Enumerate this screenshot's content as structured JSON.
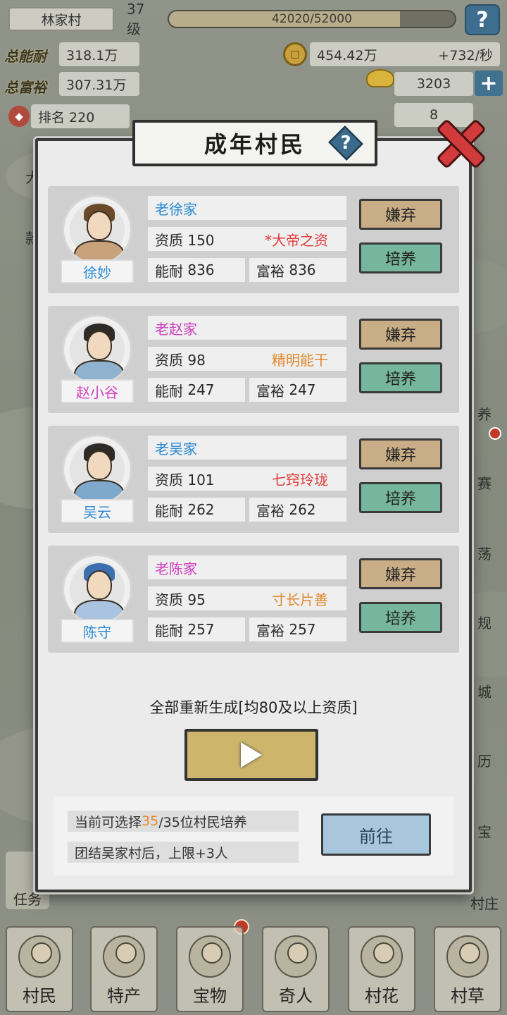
{
  "hud": {
    "village_name": "林家村",
    "level": "37级",
    "exp_text": "42020/52000",
    "exp_progress": 0.808,
    "total_ability_label": "总能耐",
    "total_ability": "318.1万",
    "total_wealth_label": "总富裕",
    "total_wealth": "307.31万",
    "rank": "排名 220",
    "coins": "454.42万",
    "coin_rate": "+732/秒",
    "ingots": "3203",
    "tickets": "8"
  },
  "side_menu": {
    "right": [
      "养",
      "赛",
      "荡",
      "规",
      "城",
      "历",
      "宝",
      "村庄"
    ],
    "left": [
      "大",
      "款"
    ],
    "task": "任务"
  },
  "modal": {
    "title": "成年村民",
    "help_icon": "question-icon",
    "close_icon": "close-x-icon",
    "villagers": [
      {
        "family": "老徐家",
        "name": "徐妙",
        "name_color": "#2a8ad4",
        "talent_label": "资质",
        "talent": "150",
        "trait": "*大帝之资",
        "trait_color": "#e03a3a",
        "ability_label": "能耐",
        "ability": "836",
        "wealth_label": "富裕",
        "wealth": "836",
        "hair_color": "#6b4a2b",
        "cloth_color": "#c7a27a"
      },
      {
        "family": "老赵家",
        "name": "赵小谷",
        "name_color": "#d13ec0",
        "talent_label": "资质",
        "talent": "98",
        "trait": "精明能干",
        "trait_color": "#e0892c",
        "ability_label": "能耐",
        "ability": "247",
        "wealth_label": "富裕",
        "wealth": "247",
        "hair_color": "#2f2a26",
        "cloth_color": "#8fb2cf"
      },
      {
        "family": "老吴家",
        "name": "吴云",
        "name_color": "#2a8ad4",
        "talent_label": "资质",
        "talent": "101",
        "trait": "七窍玲珑",
        "trait_color": "#e03a3a",
        "ability_label": "能耐",
        "ability": "262",
        "wealth_label": "富裕",
        "wealth": "262",
        "hair_color": "#2f2a26",
        "cloth_color": "#7ea9cc"
      },
      {
        "family": "老陈家",
        "name": "陈守",
        "name_color": "#2a8ad4",
        "talent_label": "资质",
        "talent": "95",
        "trait": "寸长片善",
        "trait_color": "#e0892c",
        "ability_label": "能耐",
        "ability": "257",
        "wealth_label": "富裕",
        "wealth": "257",
        "hair_color": "#3b6fb0",
        "cloth_color": "#a9c3e0"
      }
    ],
    "family_color": "#d13ec0",
    "abandon_label": "嫌弃",
    "train_label": "培养",
    "regen_text": "全部重新生成[均80及以上资质]",
    "info": {
      "line1_prefix": "当前可选择",
      "line1_highlight": "35",
      "line1_suffix": "/35位村民培养",
      "line2": "团结吴家村后，上限+3人"
    },
    "goto_label": "前往"
  },
  "bottom_nav": [
    "村民",
    "特产",
    "宝物",
    "奇人",
    "村花",
    "村草"
  ],
  "colors": {
    "abandon_bg": "#c9ad86",
    "train_bg": "#76b59e",
    "goto_bg": "#a8c6dc",
    "play_bg": "#cdb56c"
  }
}
